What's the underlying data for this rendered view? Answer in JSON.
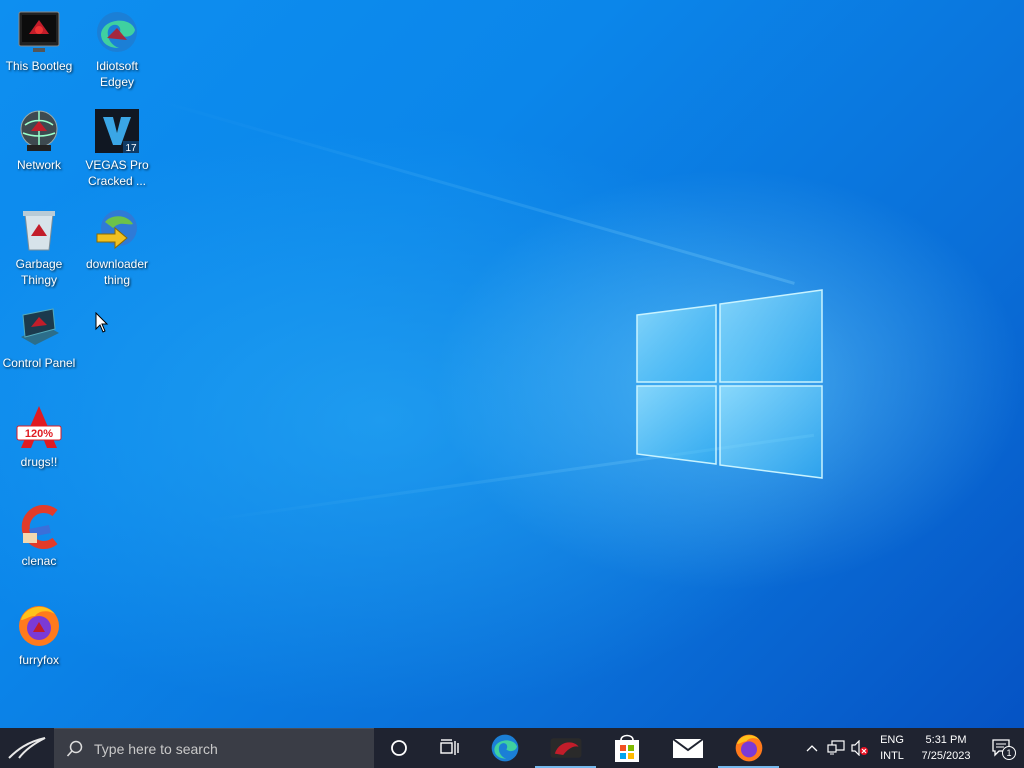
{
  "desktop": {
    "icons": [
      {
        "label": "This Bootleg",
        "icon": "computer-icon"
      },
      {
        "label": "Idiotsoft Edgey",
        "icon": "edge-icon"
      },
      {
        "label": "Network",
        "icon": "network-globe-icon"
      },
      {
        "label": "VEGAS Pro Cracked ...",
        "icon": "vegas-pro-icon",
        "badge": "17"
      },
      {
        "label": "Garbage Thingy",
        "icon": "recycle-bin-icon"
      },
      {
        "label": "downloader thing",
        "icon": "download-manager-icon"
      },
      {
        "label": "Control Panel",
        "icon": "control-panel-icon"
      },
      {
        "label": "drugs!!",
        "icon": "acrobat-icon",
        "badge": "120%"
      },
      {
        "label": "clenac",
        "icon": "ccleaner-icon"
      },
      {
        "label": "furryfox",
        "icon": "firefox-icon"
      }
    ]
  },
  "taskbar": {
    "search_placeholder": "Type here to search",
    "apps": [
      {
        "name": "edge",
        "icon": "edge-icon",
        "active": false
      },
      {
        "name": "rog-app",
        "icon": "rog-app-icon",
        "active": true
      },
      {
        "name": "store",
        "icon": "store-icon",
        "active": false
      },
      {
        "name": "mail",
        "icon": "mail-icon",
        "active": false
      },
      {
        "name": "firefox",
        "icon": "firefox-icon",
        "active": true
      }
    ],
    "tray": {
      "lang_top": "ENG",
      "lang_bottom": "INTL",
      "time": "5:31 PM",
      "date": "7/25/2023",
      "notification_count": "1"
    }
  },
  "colors": {
    "taskbar_bg": "#1f2330",
    "search_bg": "#3a3d46",
    "wallpaper_blue": "#0b86ea",
    "accent": "#76b9ed"
  }
}
